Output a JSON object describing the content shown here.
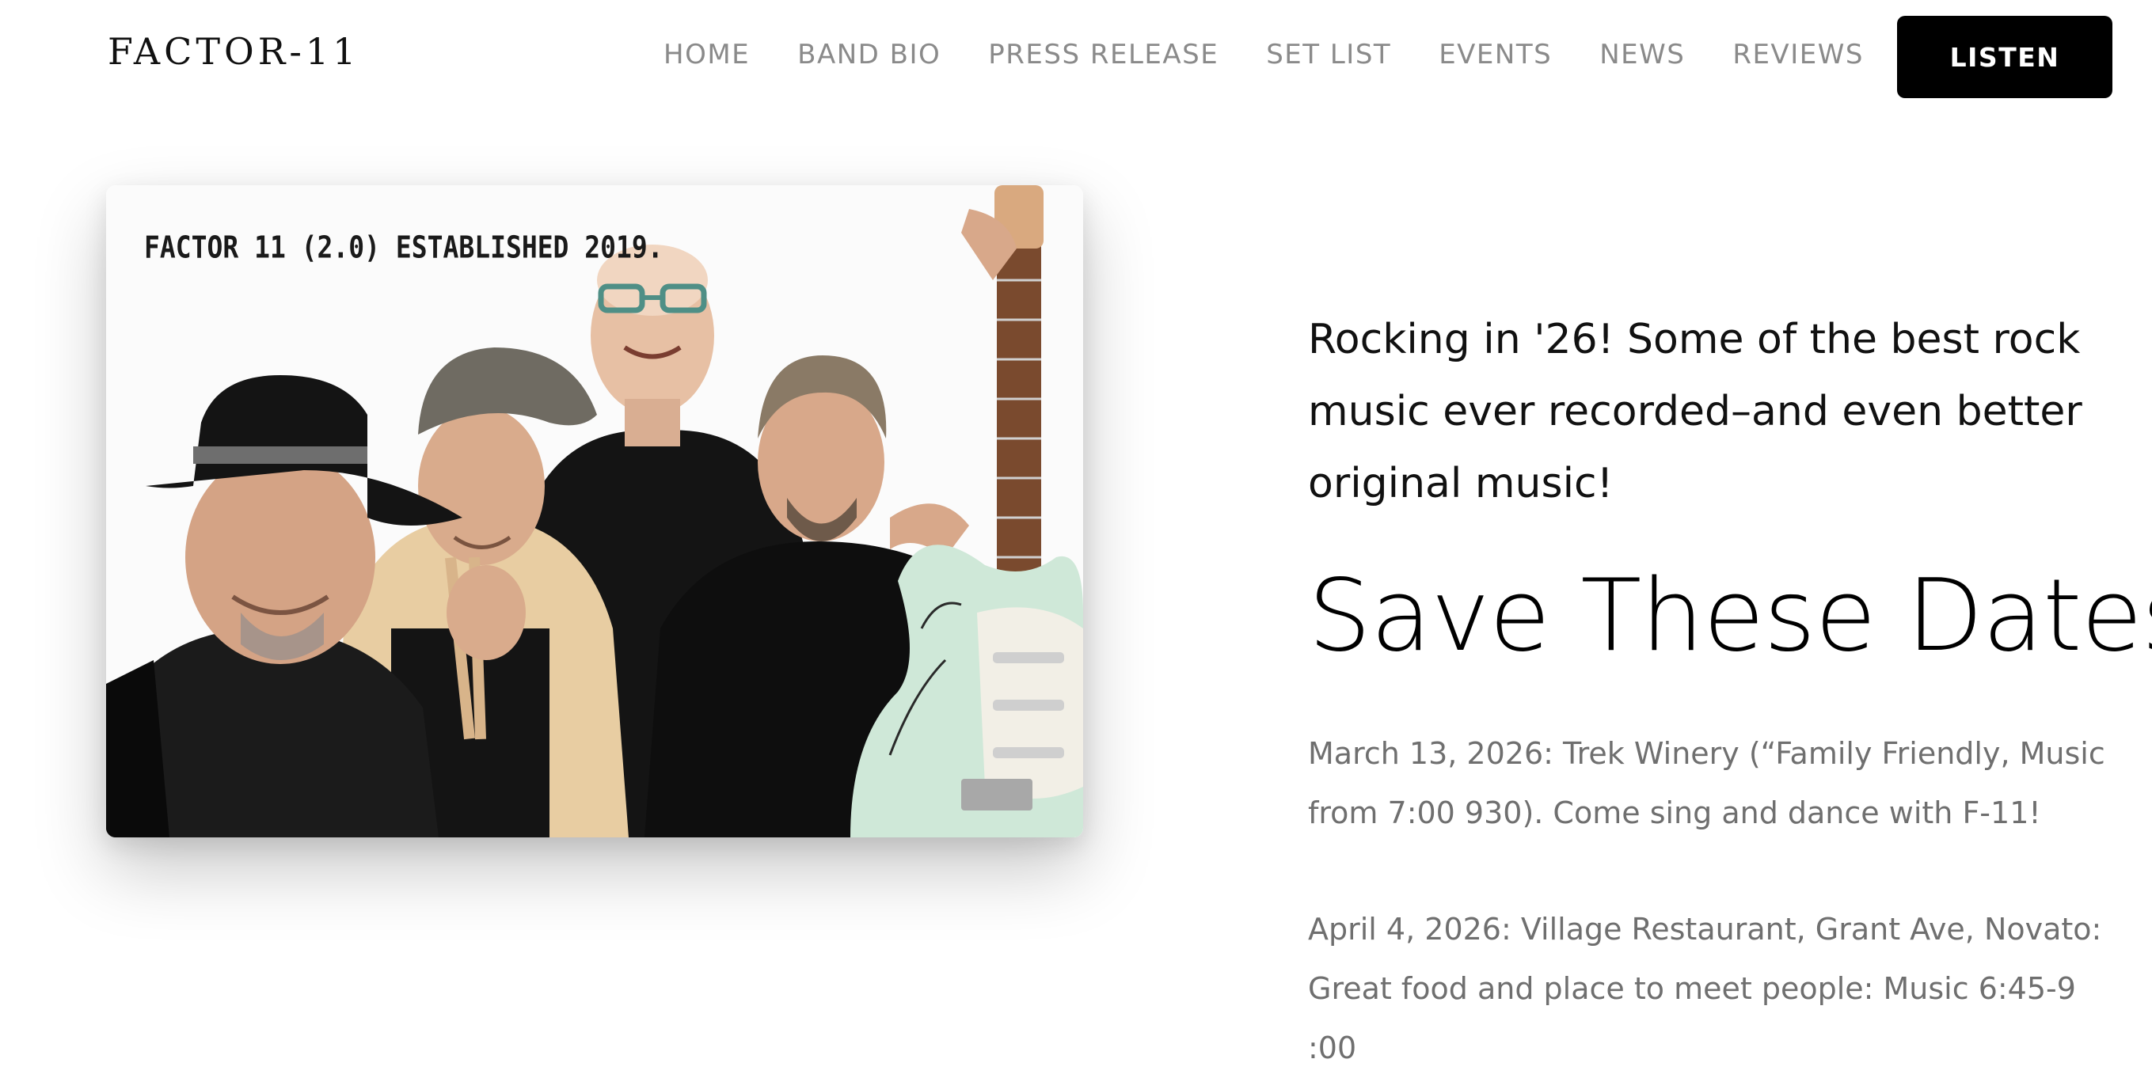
{
  "header": {
    "logo": "FACTOR-11",
    "nav": [
      {
        "label": "HOME"
      },
      {
        "label": "BAND BIO"
      },
      {
        "label": "PRESS RELEASE"
      },
      {
        "label": "SET LIST"
      },
      {
        "label": "EVENTS"
      },
      {
        "label": "NEWS"
      },
      {
        "label": "REVIEWS"
      }
    ],
    "listen_label": "LISTEN"
  },
  "photo": {
    "caption": "FACTOR 11 (2.0) ESTABLISHED 2019."
  },
  "main": {
    "intro": "Rocking in '26! Some of the best rock music ever recorded–and even better original music!",
    "heading": "Save These Dates",
    "events": [
      {
        "text": "March 13, 2026: Trek Winery (“Family Friendly, Music from 7:00 930). Come sing and dance with F-11!"
      },
      {
        "text": "April 4, 2026: Village Restaurant, Grant Ave, Novato: Great food and place to meet people: Music 6:45-9 :00"
      }
    ]
  },
  "colors": {
    "nav_text": "#8a8a8a",
    "button_bg": "#000000",
    "button_text": "#ffffff",
    "body_text": "#111111",
    "event_text": "#6f6f6f",
    "guitar_body": "#cfe8d8"
  },
  "icons": {
    "photo": "band-photo"
  }
}
